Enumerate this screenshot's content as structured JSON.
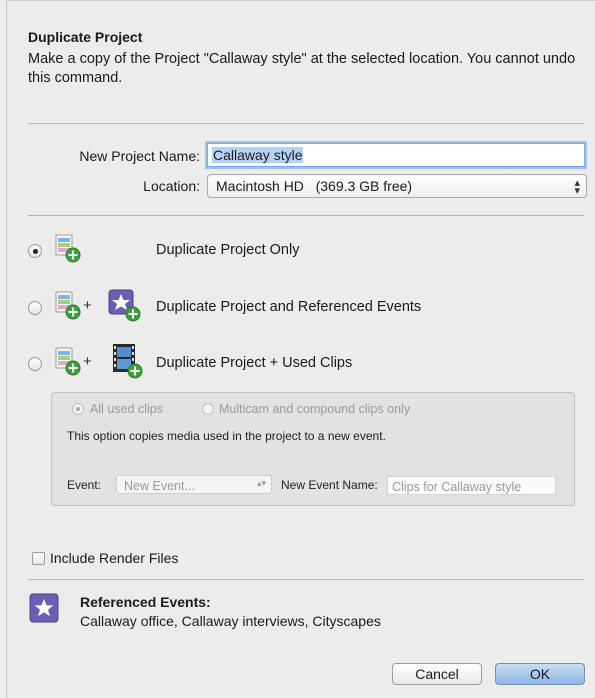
{
  "dialog": {
    "title": "Duplicate Project",
    "description": "Make a copy of the Project \"Callaway style\" at the selected location. You cannot undo this command."
  },
  "form": {
    "name_label": "New Project Name:",
    "name_value": "Callaway style",
    "location_label": "Location:",
    "location_value": "Macintosh HD   (369.3 GB free)"
  },
  "options": [
    {
      "label": "Duplicate Project Only",
      "selected": true,
      "icons": [
        "project-icon"
      ]
    },
    {
      "label": "Duplicate Project and Referenced Events",
      "selected": false,
      "icons": [
        "project-icon",
        "event-star-icon"
      ]
    },
    {
      "label": "Duplicate Project + Used Clips",
      "selected": false,
      "icons": [
        "project-icon",
        "clips-filmstrip-icon"
      ]
    }
  ],
  "plus_sign": "+",
  "clips_panel": {
    "radio_all": "All used clips",
    "radio_multicam": "Multicam and compound clips only",
    "info": "This option copies media used in the project to a new event.",
    "event_label": "Event:",
    "event_value": "New Event...",
    "event_name_label": "New Event Name:",
    "event_name_placeholder": "Clips for Callaway style"
  },
  "render": {
    "label": "Include Render Files",
    "checked": false
  },
  "referenced": {
    "title": "Referenced Events:",
    "list": "Callaway office, Callaway interviews, Cityscapes"
  },
  "buttons": {
    "cancel": "Cancel",
    "ok": "OK"
  },
  "colors": {
    "accent": "#7aa7de",
    "selection": "#b4d2f6",
    "default_button": "#8db5e4",
    "star_icon": "#6a5fb3",
    "add_badge": "#3aa33a"
  }
}
